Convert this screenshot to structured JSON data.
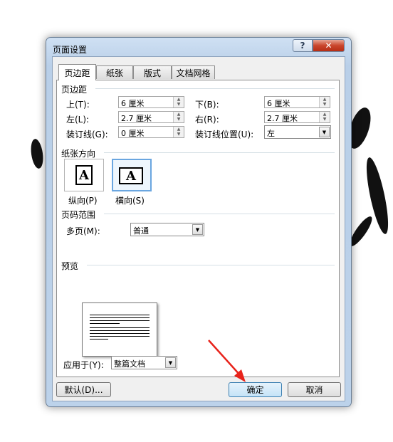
{
  "dialog": {
    "title": "页面设置",
    "help_label": "?",
    "close_label": "✕"
  },
  "tabs": [
    "页边距",
    "纸张",
    "版式",
    "文档网格"
  ],
  "margins": {
    "section": "页边距",
    "top_label": "上(T):",
    "top_value": "6 厘米",
    "bottom_label": "下(B):",
    "bottom_value": "6 厘米",
    "left_label": "左(L):",
    "left_value": "2.7 厘米",
    "right_label": "右(R):",
    "right_value": "2.7 厘米",
    "gutter_label": "装订线(G):",
    "gutter_value": "0 厘米",
    "gutter_pos_label": "装订线位置(U):",
    "gutter_pos_value": "左"
  },
  "orientation": {
    "section": "纸张方向",
    "portrait_label": "纵向(P)",
    "landscape_label": "横向(S)",
    "glyph": "A"
  },
  "pages": {
    "section": "页码范围",
    "multi_label": "多页(M):",
    "multi_value": "普通"
  },
  "preview": {
    "section": "预览",
    "apply_label": "应用于(Y):",
    "apply_value": "整篇文档"
  },
  "buttons": {
    "default": "默认(D)...",
    "ok": "确定",
    "cancel": "取消"
  },
  "colors": {
    "arrow": "#e8231b",
    "close": "#c9452b",
    "selection": "#6aa6e0"
  }
}
